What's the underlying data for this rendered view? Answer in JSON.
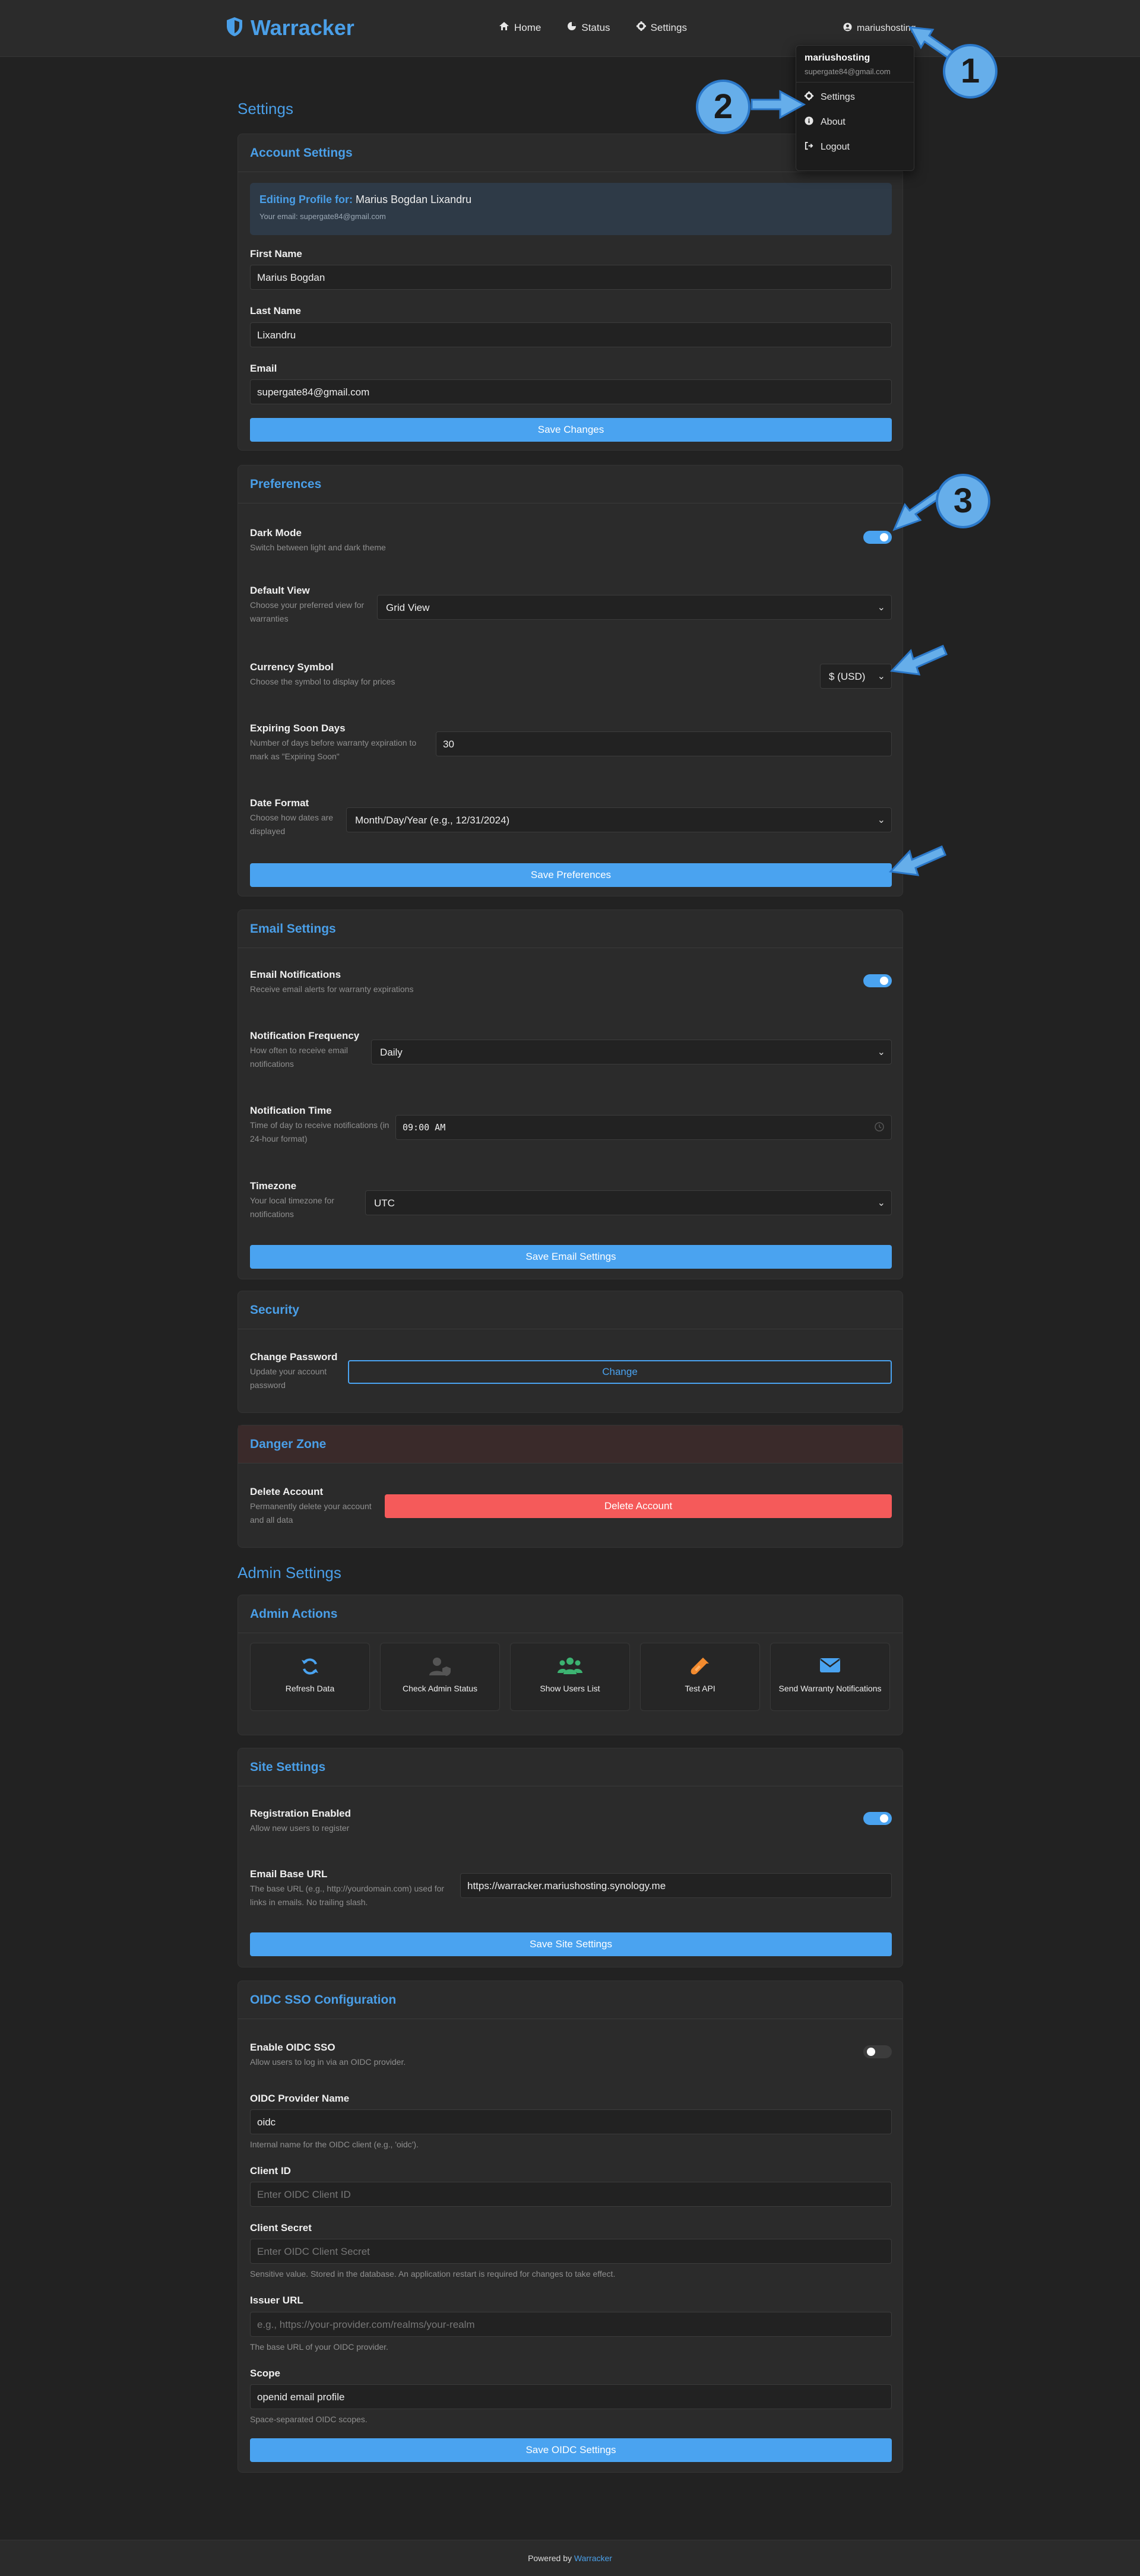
{
  "header": {
    "app_name": "Warracker",
    "nav": {
      "home": "Home",
      "status": "Status",
      "settings": "Settings"
    },
    "username": "mariushosting"
  },
  "dropdown": {
    "name": "mariushosting",
    "email": "supergate84@gmail.com",
    "items": {
      "settings": "Settings",
      "about": "About",
      "logout": "Logout"
    }
  },
  "page_title": "Settings",
  "account": {
    "title": "Account Settings",
    "profile_prefix": "Editing Profile for:",
    "profile_name": "Marius Bogdan Lixandru",
    "profile_email": "Your email: supergate84@gmail.com",
    "first_name_label": "First Name",
    "first_name": "Marius Bogdan",
    "last_name_label": "Last Name",
    "last_name": "Lixandru",
    "email_label": "Email",
    "email": "supergate84@gmail.com",
    "save": "Save Changes"
  },
  "preferences": {
    "title": "Preferences",
    "dark_mode_label": "Dark Mode",
    "dark_mode_desc": "Switch between light and dark theme",
    "dark_mode_on": true,
    "default_view_label": "Default View",
    "default_view_desc1": "Choose your preferred view for",
    "default_view_desc2": "warranties",
    "default_view": "Grid View",
    "currency_label": "Currency Symbol",
    "currency_desc": "Choose the symbol to display for prices",
    "currency": "$ (USD)",
    "expiring_label": "Expiring Soon Days",
    "expiring_desc1": "Number of days before warranty expiration to",
    "expiring_desc2": "mark as \"Expiring Soon\"",
    "expiring_value": "30",
    "date_label": "Date Format",
    "date_desc1": "Choose how dates are",
    "date_desc2": "displayed",
    "date_value": "Month/Day/Year (e.g., 12/31/2024)",
    "save": "Save Preferences"
  },
  "email_settings": {
    "title": "Email Settings",
    "notif_label": "Email Notifications",
    "notif_desc": "Receive email alerts for warranty expirations",
    "notif_on": true,
    "freq_label": "Notification Frequency",
    "freq_desc1": "How often to receive email",
    "freq_desc2": "notifications",
    "freq_value": "Daily",
    "time_label": "Notification Time",
    "time_desc1": "Time of day to receive notifications (in",
    "time_desc2": "24-hour format)",
    "time_value": "09:00 AM",
    "tz_label": "Timezone",
    "tz_desc1": "Your local timezone for",
    "tz_desc2": "notifications",
    "tz_value": "UTC",
    "save": "Save Email Settings"
  },
  "security": {
    "title": "Security",
    "label": "Change Password",
    "desc1": "Update your account",
    "desc2": "password",
    "button": "Change"
  },
  "danger": {
    "title": "Danger Zone",
    "label": "Delete Account",
    "desc1": "Permanently delete your account",
    "desc2": "and all data",
    "button": "Delete Account"
  },
  "admin_title": "Admin Settings",
  "admin_actions": {
    "title": "Admin Actions",
    "refresh": "Refresh Data",
    "check": "Check Admin Status",
    "users": "Show Users List",
    "test": "Test API",
    "send": "Send Warranty Notifications"
  },
  "site": {
    "title": "Site Settings",
    "reg_label": "Registration Enabled",
    "reg_desc": "Allow new users to register",
    "reg_on": true,
    "url_label": "Email Base URL",
    "url_desc1": "The base URL (e.g., http://yourdomain.com) used for",
    "url_desc2": "links in emails. No trailing slash.",
    "url_value": "https://warracker.mariushosting.synology.me",
    "save": "Save Site Settings"
  },
  "oidc": {
    "title": "OIDC SSO Configuration",
    "enable_label": "Enable OIDC SSO",
    "enable_desc": "Allow users to log in via an OIDC provider.",
    "enable_on": false,
    "provider_label": "OIDC Provider Name",
    "provider_value": "oidc",
    "provider_help": "Internal name for the OIDC client (e.g., 'oidc').",
    "client_id_label": "Client ID",
    "client_id_ph": "Enter OIDC Client ID",
    "secret_label": "Client Secret",
    "secret_ph": "Enter OIDC Client Secret",
    "secret_help": "Sensitive value. Stored in the database. An application restart is required for changes to take effect.",
    "issuer_label": "Issuer URL",
    "issuer_ph": "e.g., https://your-provider.com/realms/your-realm",
    "issuer_help": "The base URL of your OIDC provider.",
    "scope_label": "Scope",
    "scope_value": "openid email profile",
    "scope_help": "Space-separated OIDC scopes.",
    "save": "Save OIDC Settings"
  },
  "footer": {
    "prefix": "Powered by",
    "brand": "Warracker"
  },
  "callouts": {
    "one": "1",
    "two": "2",
    "three": "3"
  },
  "colors": {
    "accent": "#4aa3f0",
    "danger": "#f55a5a",
    "background": "#222222",
    "card": "#2b2b2b"
  }
}
